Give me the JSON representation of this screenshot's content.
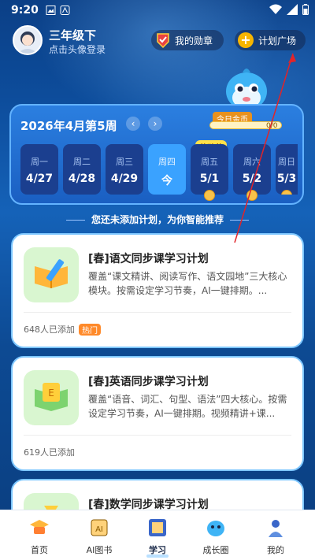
{
  "status_bar": {
    "time": "9:20"
  },
  "header": {
    "grade": "三年级下",
    "login_hint": "点击头像登录",
    "medal_label": "我的勋章",
    "plan_square_label": "计划广场"
  },
  "coins": {
    "label": "今日金币",
    "value": "0/0"
  },
  "week": {
    "title": "2026年4月第5周",
    "holiday": "劳动节",
    "days": [
      {
        "name": "周一",
        "date": "4/27",
        "coin": false,
        "today": false
      },
      {
        "name": "周二",
        "date": "4/28",
        "coin": false,
        "today": false
      },
      {
        "name": "周三",
        "date": "4/29",
        "coin": false,
        "today": false
      },
      {
        "name": "周四",
        "date": "今",
        "coin": false,
        "today": true
      },
      {
        "name": "周五",
        "date": "5/1",
        "coin": true,
        "today": false
      },
      {
        "name": "周六",
        "date": "5/2",
        "coin": true,
        "today": false
      },
      {
        "name": "周日",
        "date": "5/3",
        "coin": true,
        "today": false
      }
    ]
  },
  "recommend_text": "您还未添加计划，为你智能推荐",
  "plans": [
    {
      "title": "[春]语文同步课学习计划",
      "desc": "覆盖“课文精讲、阅读写作、语文园地”三大核心模块。按需设定学习节奏，AI一键排期。...",
      "count": "648人已添加",
      "hot": "热门"
    },
    {
      "title": "[春]英语同步课学习计划",
      "desc": "覆盖“语音、词汇、句型、语法”四大核心。按需设定学习节奏，AI一键排期。视频精讲+课...",
      "count": "619人已添加",
      "hot": ""
    },
    {
      "title": "[春]数学同步课学习计划",
      "desc": "",
      "count": "",
      "hot": ""
    }
  ],
  "bottom_nav": [
    {
      "label": "首页"
    },
    {
      "label": "AI图书"
    },
    {
      "label": "学习"
    },
    {
      "label": "成长圈"
    },
    {
      "label": "我的"
    }
  ],
  "colors": {
    "accent": "#3aa2ff",
    "card_border": "#7cc6ff",
    "hot": "#ff8a2a",
    "coin": "#f8c24a"
  }
}
